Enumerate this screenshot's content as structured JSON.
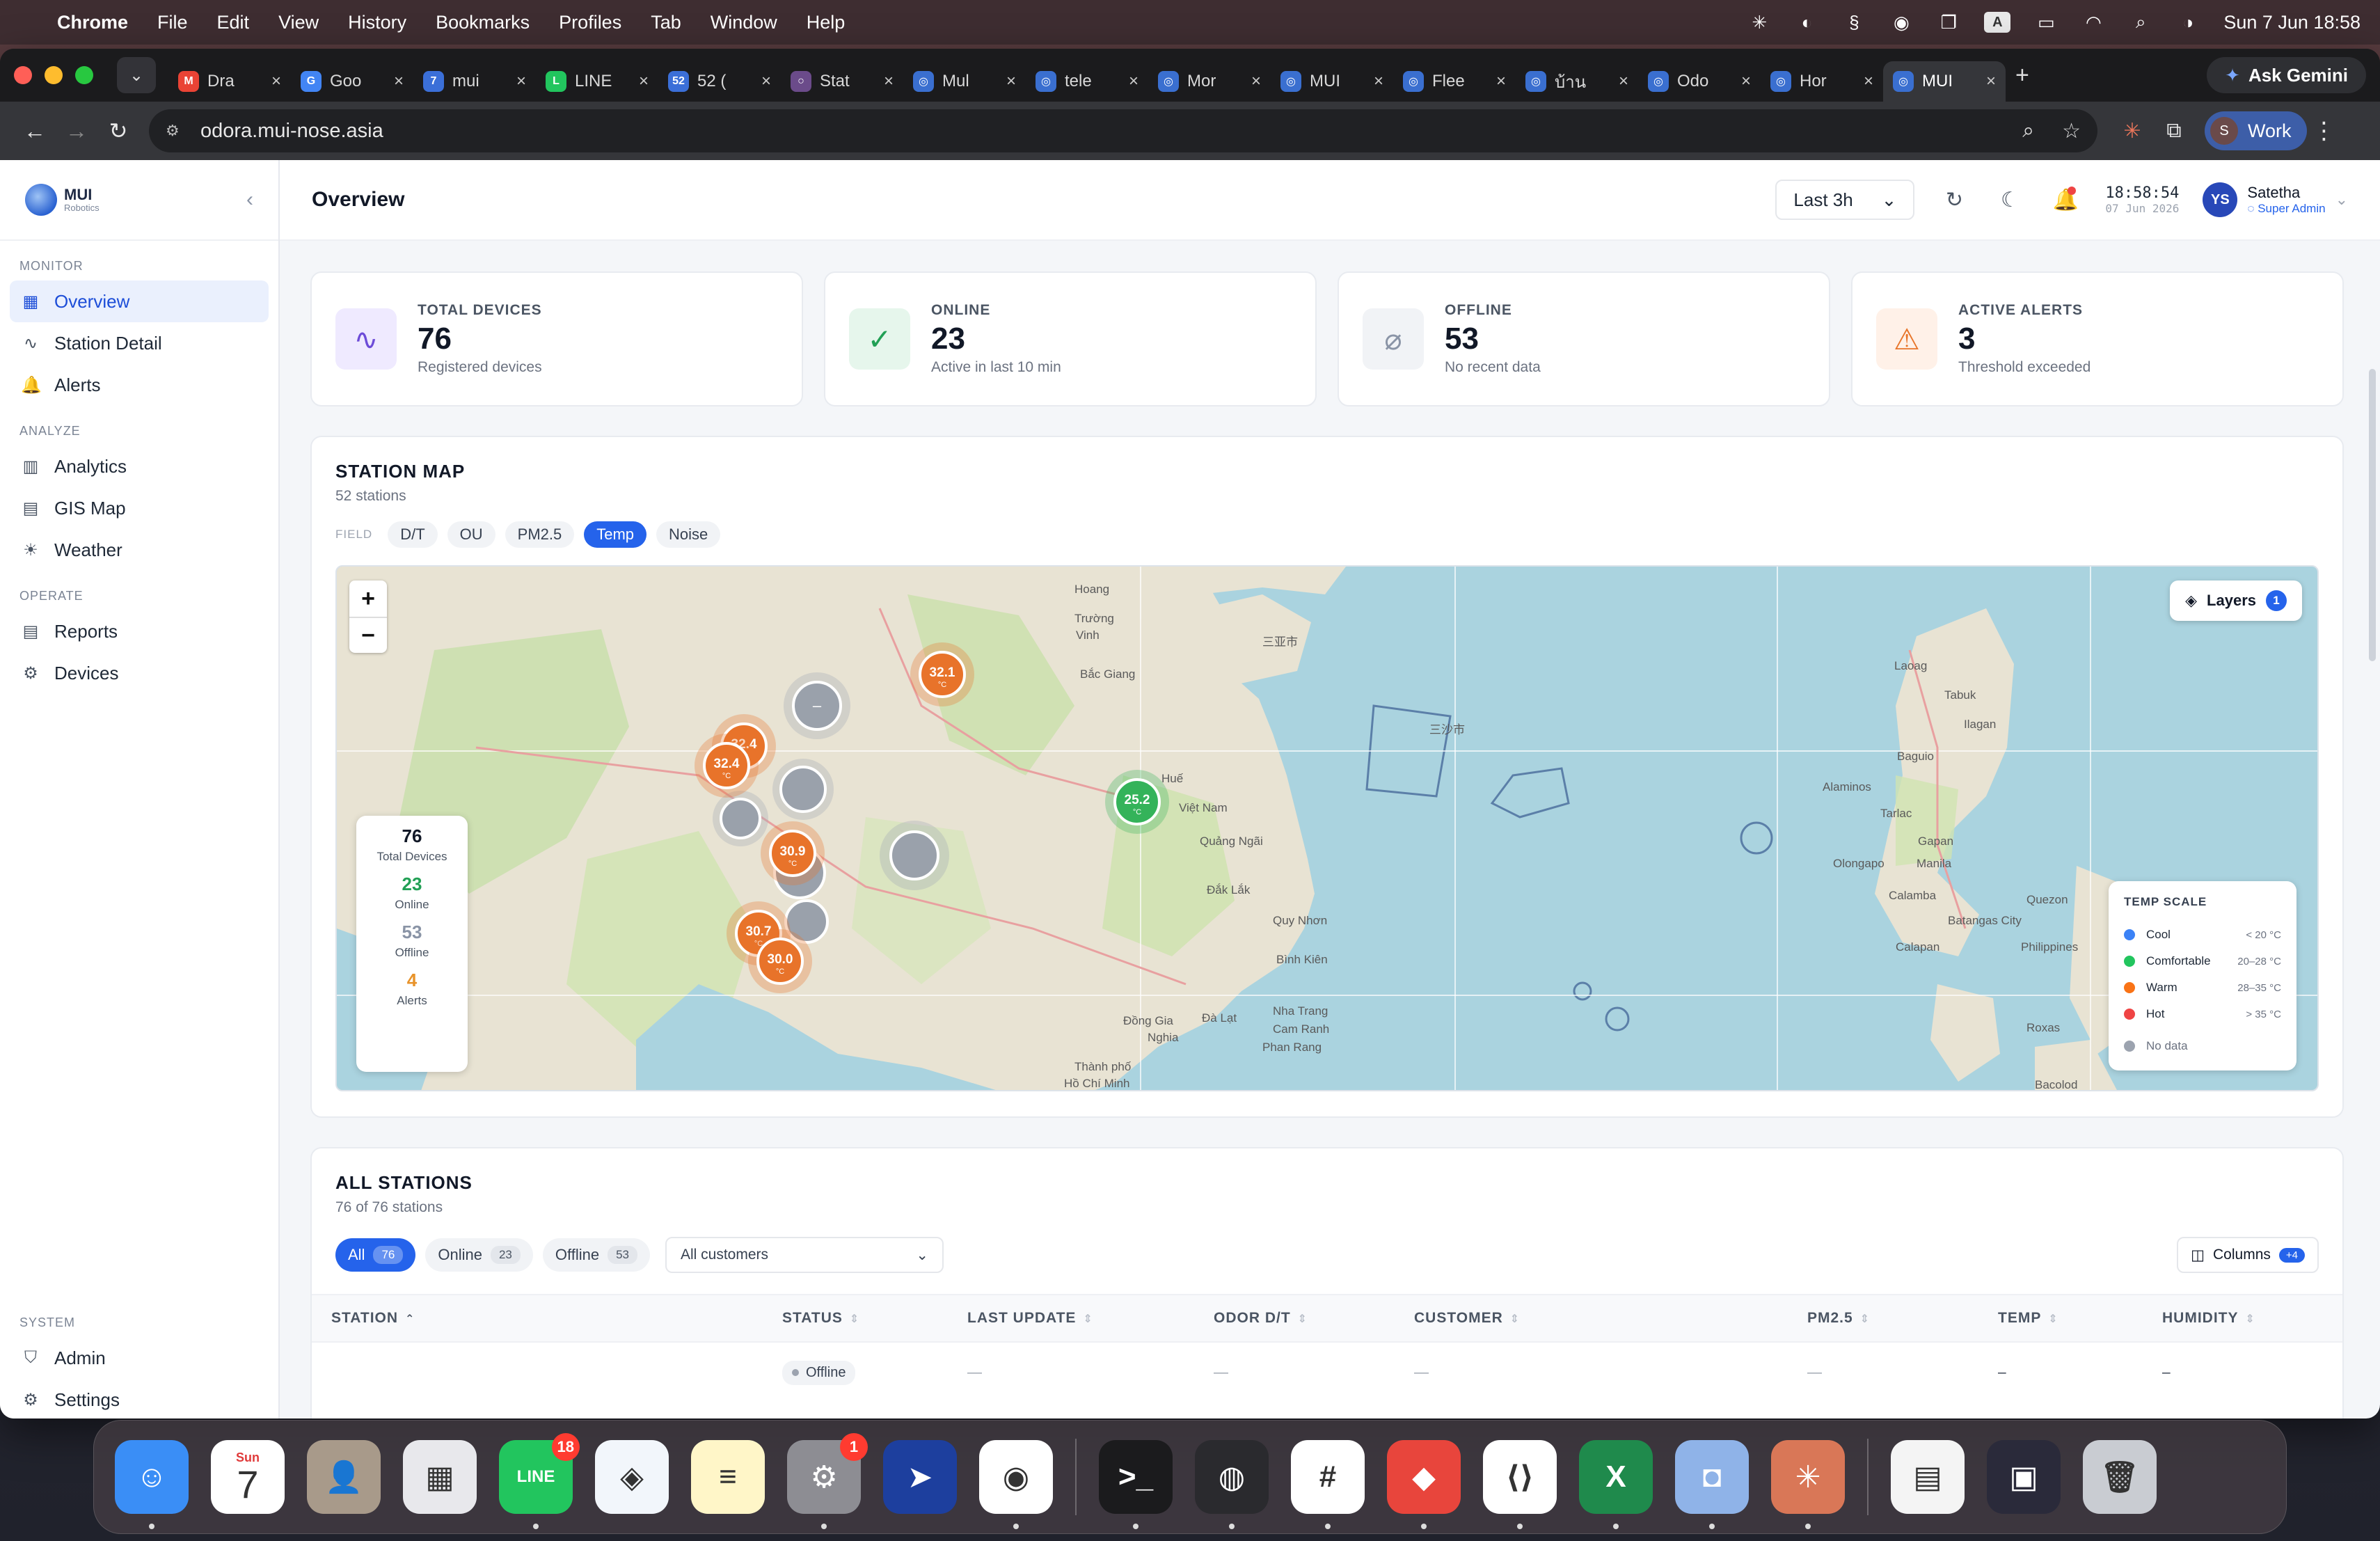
{
  "menubar": {
    "app": "Chrome",
    "items": [
      "File",
      "Edit",
      "View",
      "History",
      "Bookmarks",
      "Profiles",
      "Tab",
      "Window",
      "Help"
    ],
    "datetime": "Sun 7 Jun  18:58",
    "input_source": "A"
  },
  "browser": {
    "tabs": [
      {
        "title": "Dra",
        "icon": "gmail-icon",
        "color": "#ea4335",
        "glyph": "M"
      },
      {
        "title": "Goo",
        "icon": "google-translate-icon",
        "color": "#4285f4",
        "glyph": "G"
      },
      {
        "title": "mui",
        "icon": "seven-icon",
        "color": "#3b6fd8",
        "glyph": "7"
      },
      {
        "title": "LINE",
        "icon": "line-shield-icon",
        "color": "#22c55e",
        "glyph": "L"
      },
      {
        "title": "52 (",
        "icon": "count-52-icon",
        "color": "#3b6fd8",
        "glyph": "52"
      },
      {
        "title": "Stat",
        "icon": "circle-icon",
        "color": "#6b4b8a",
        "glyph": "○"
      },
      {
        "title": "Mul",
        "icon": "globe-icon",
        "color": "#3a6fd0",
        "glyph": "◎"
      },
      {
        "title": "tele",
        "icon": "globe-icon",
        "color": "#3a6fd0",
        "glyph": "◎"
      },
      {
        "title": "Mor",
        "icon": "globe-icon",
        "color": "#3a6fd0",
        "glyph": "◎"
      },
      {
        "title": "MUI",
        "icon": "globe-icon",
        "color": "#3a6fd0",
        "glyph": "◎"
      },
      {
        "title": "Flee",
        "icon": "globe-icon",
        "color": "#3a6fd0",
        "glyph": "◎"
      },
      {
        "title": "บ้าน",
        "icon": "globe-icon",
        "color": "#3a6fd0",
        "glyph": "◎"
      },
      {
        "title": "Odo",
        "icon": "globe-icon",
        "color": "#3a6fd0",
        "glyph": "◎"
      },
      {
        "title": "Hor",
        "icon": "globe-icon",
        "color": "#3a6fd0",
        "glyph": "◎"
      },
      {
        "title": "MUI",
        "icon": "globe-icon",
        "color": "#3a6fd0",
        "glyph": "◎",
        "active": true
      }
    ],
    "ask_gemini": "Ask Gemini",
    "url": "odora.mui-nose.asia",
    "profile": {
      "initial": "S",
      "name": "Work"
    }
  },
  "sidebar": {
    "brand": {
      "name": "MUI",
      "sub": "Robotics"
    },
    "sections": [
      {
        "title": "MONITOR",
        "items": [
          {
            "label": "Overview",
            "icon": "grid-icon",
            "glyph": "▦",
            "active": true
          },
          {
            "label": "Station Detail",
            "icon": "activity-icon",
            "glyph": "∿"
          },
          {
            "label": "Alerts",
            "icon": "bell-icon",
            "glyph": "🔔"
          }
        ]
      },
      {
        "title": "ANALYZE",
        "items": [
          {
            "label": "Analytics",
            "icon": "bar-chart-icon",
            "glyph": "▥"
          },
          {
            "label": "GIS Map",
            "icon": "map-icon",
            "glyph": "▤"
          },
          {
            "label": "Weather",
            "icon": "sun-cloud-icon",
            "glyph": "☀"
          }
        ]
      },
      {
        "title": "OPERATE",
        "items": [
          {
            "label": "Reports",
            "icon": "document-icon",
            "glyph": "▤"
          },
          {
            "label": "Devices",
            "icon": "cog-chip-icon",
            "glyph": "⚙"
          }
        ]
      }
    ],
    "system": {
      "title": "SYSTEM",
      "items": [
        {
          "label": "Admin",
          "icon": "shield-icon",
          "glyph": "⛉"
        },
        {
          "label": "Settings",
          "icon": "gear-icon",
          "glyph": "⚙"
        }
      ]
    }
  },
  "topbar": {
    "title": "Overview",
    "range": "Last 3h",
    "time": "18:58:54",
    "date": "07 Jun 2026",
    "user": {
      "initials": "YS",
      "name": "Satetha",
      "role": "Super Admin"
    }
  },
  "cards": [
    {
      "label": "TOTAL DEVICES",
      "value": "76",
      "sub": "Registered devices",
      "icon": "pulse-icon",
      "glyph": "∿",
      "bg": "#efeaff",
      "fg": "#6d4cd8"
    },
    {
      "label": "ONLINE",
      "value": "23",
      "sub": "Active in last 10 min",
      "icon": "check-circle-icon",
      "glyph": "✓",
      "bg": "#e6f6ec",
      "fg": "#22a055"
    },
    {
      "label": "OFFLINE",
      "value": "53",
      "sub": "No recent data",
      "icon": "wifi-off-icon",
      "glyph": "⌀",
      "bg": "#f1f3f6",
      "fg": "#8a94a6"
    },
    {
      "label": "ACTIVE ALERTS",
      "value": "3",
      "sub": "Threshold exceeded",
      "icon": "warning-icon",
      "glyph": "⚠",
      "bg": "#fff1e8",
      "fg": "#e8752a"
    }
  ],
  "station_map": {
    "title": "STATION MAP",
    "subtitle": "52 stations",
    "field_label": "FIELD",
    "fields": [
      {
        "label": "D/T"
      },
      {
        "label": "OU"
      },
      {
        "label": "PM2.5"
      },
      {
        "label": "Temp",
        "active": true
      },
      {
        "label": "Noise"
      }
    ],
    "layers": {
      "label": "Layers",
      "count": "1"
    },
    "stats": [
      {
        "value": "76",
        "label": "Total Devices",
        "color": "#111827"
      },
      {
        "value": "23",
        "label": "Online",
        "color": "#22a055"
      },
      {
        "value": "53",
        "label": "Offline",
        "color": "#8a94a6"
      },
      {
        "value": "4",
        "label": "Alerts",
        "color": "#e8932a"
      }
    ],
    "scale": {
      "title": "TEMP SCALE",
      "rows": [
        {
          "label": "Cool",
          "range": "< 20 °C",
          "color": "#3b82f6"
        },
        {
          "label": "Comfortable",
          "range": "20–28 °C",
          "color": "#22c55e"
        },
        {
          "label": "Warm",
          "range": "28–35 °C",
          "color": "#f97316"
        },
        {
          "label": "Hot",
          "range": "> 35 °C",
          "color": "#ef4444"
        },
        {
          "label": "No data",
          "range": "",
          "color": "#9ca3af"
        }
      ]
    },
    "markers": [
      {
        "value": "32.1",
        "unit": "°C",
        "color": "#e8732a"
      },
      {
        "value": "32.4",
        "unit": "°C",
        "color": "#e8732a"
      },
      {
        "value": "32.4",
        "unit": "°C",
        "color": "#e8732a"
      },
      {
        "value": "30.9",
        "unit": "°C",
        "color": "#e8732a"
      },
      {
        "value": "30.7",
        "unit": "°C",
        "color": "#e8732a"
      },
      {
        "value": "30.0",
        "unit": "°C",
        "color": "#e8732a"
      },
      {
        "value": "25.2",
        "unit": "°C",
        "color": "#34b35a"
      }
    ],
    "place_labels": [
      "Hoang",
      "Trường",
      "Vinh",
      "Bắc Giang",
      "Huế",
      "Việt Nam",
      "Quảng Ngãi",
      "Đắk Lắk",
      "Quy Nhơn",
      "Bình Kiên",
      "Nha Trang",
      "Cam Ranh",
      "Phan Rang",
      "Đà Lạt",
      "Đồng Gia",
      "Nghia",
      "Thành phố",
      "Hồ Chí Minh",
      "Laoag",
      "Tabuk",
      "Ilagan",
      "Baguio",
      "Alaminos",
      "Tarlac",
      "Gapan",
      "Manila",
      "Olongapo",
      "Calamba",
      "Batangas City",
      "Quezon",
      "Philippines",
      "Calapan",
      "Roxas",
      "Bacolod",
      "三亚市",
      "三沙市"
    ]
  },
  "all_stations": {
    "title": "ALL STATIONS",
    "subtitle": "76 of 76 stations",
    "filters": [
      {
        "label": "All",
        "count": "76",
        "active": true
      },
      {
        "label": "Online",
        "count": "23"
      },
      {
        "label": "Offline",
        "count": "53"
      }
    ],
    "customer_select": "All customers",
    "columns_button": {
      "label": "Columns",
      "badge": "+4"
    },
    "columns": [
      "STATION",
      "STATUS",
      "LAST UPDATE",
      "ODOR D/T",
      "CUSTOMER",
      "PM2.5",
      "TEMP",
      "HUMIDITY"
    ],
    "rows": [
      {
        "station": "",
        "status": "Offline",
        "last_update": "—",
        "odor": "—",
        "customer": "—",
        "pm25": "—",
        "temp": "–",
        "humidity": "–"
      }
    ]
  },
  "dock": {
    "apps": [
      {
        "name": "finder-icon",
        "color": "#3a8ef6",
        "glyph": "☺",
        "running": true
      },
      {
        "name": "calendar-icon",
        "color": "#ffffff",
        "glyph": "7",
        "running": false,
        "label": "Sun"
      },
      {
        "name": "contacts-icon",
        "color": "#a89a8a",
        "glyph": "👤",
        "running": false
      },
      {
        "name": "launchpad-icon",
        "color": "#e8e8ec",
        "glyph": "▦",
        "running": false
      },
      {
        "name": "line-app-icon",
        "color": "#22c55e",
        "glyph": "LINE",
        "running": true,
        "badge": "18"
      },
      {
        "name": "safari-icon",
        "color": "#f2f6fb",
        "glyph": "◈",
        "running": false
      },
      {
        "name": "notes-icon",
        "color": "#fff6c8",
        "glyph": "≡",
        "running": false
      },
      {
        "name": "system-settings-icon",
        "color": "#8d8d93",
        "glyph": "⚙",
        "running": true,
        "badge": "1"
      },
      {
        "name": "paper-plane-icon",
        "color": "#1d3f9e",
        "glyph": "➤",
        "running": false
      },
      {
        "name": "chrome-icon",
        "color": "#ffffff",
        "glyph": "◉",
        "running": true
      },
      {
        "name": "terminal-icon",
        "color": "#1b1b1d",
        "glyph": ">_",
        "running": true
      },
      {
        "name": "linear-icon",
        "color": "#2a2a2e",
        "glyph": "◍",
        "running": true
      },
      {
        "name": "slack-icon",
        "color": "#ffffff",
        "glyph": "#",
        "running": true
      },
      {
        "name": "anydesk-icon",
        "color": "#e8453c",
        "glyph": "◆",
        "running": true
      },
      {
        "name": "vscode-icon",
        "color": "#ffffff",
        "glyph": "⟨⟩",
        "running": true
      },
      {
        "name": "excel-icon",
        "color": "#1f8a4c",
        "glyph": "X",
        "running": true
      },
      {
        "name": "jar-app-icon",
        "color": "#8fb3e8",
        "glyph": "◘",
        "running": true
      },
      {
        "name": "claude-icon",
        "color": "#d97757",
        "glyph": "✳",
        "running": true
      },
      {
        "name": "document-thumb-icon",
        "color": "#f4f4f4",
        "glyph": "▤",
        "running": false
      },
      {
        "name": "screenshot-thumb-icon",
        "color": "#2a2a3a",
        "glyph": "▣",
        "running": false
      },
      {
        "name": "trash-icon",
        "color": "#c9ccd2",
        "glyph": "🗑",
        "running": false
      }
    ]
  }
}
